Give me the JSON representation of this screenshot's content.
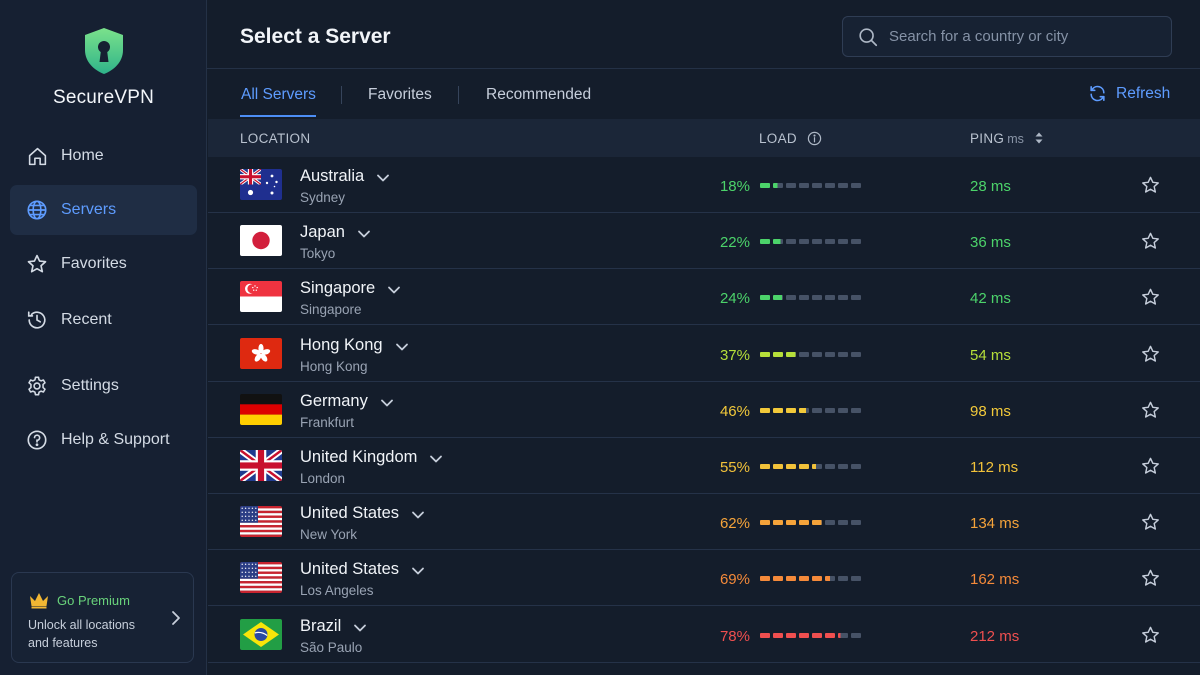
{
  "app": {
    "brand": "SecureVPN",
    "colors": {
      "accent": "#5e9cff",
      "brand_green": "#5fd38a",
      "premium_gold": "#f2b733",
      "background": "#141d2b"
    }
  },
  "sidebar": {
    "items": [
      {
        "label": "Home",
        "icon": "home-icon",
        "active": false
      },
      {
        "label": "Servers",
        "icon": "globe-icon",
        "active": true
      },
      {
        "label": "Favorites",
        "icon": "star-icon",
        "active": false
      },
      {
        "label": "Recent",
        "icon": "history-icon",
        "active": false
      },
      {
        "label": "Settings",
        "icon": "gear-icon",
        "active": false
      },
      {
        "label": "Help & Support",
        "icon": "help-icon",
        "active": false
      }
    ],
    "premium": {
      "title": "Go Premium",
      "subtitle": "Unlock all locations and features",
      "icon": "crown-icon"
    }
  },
  "header": {
    "title": "Select a Server",
    "search_placeholder": "Search for a country or city"
  },
  "tabs": [
    {
      "label": "All Servers",
      "active": true
    },
    {
      "label": "Favorites",
      "active": false
    },
    {
      "label": "Recommended",
      "active": false
    }
  ],
  "refresh_label": "Refresh",
  "table": {
    "col_location": "LOCATION",
    "col_load": "LOAD",
    "col_ping": "PING",
    "col_ping_unit": "ms",
    "rows": [
      {
        "country": "Australia",
        "city": "Sydney",
        "flag": "au",
        "load": "18%",
        "load_value": 0.18,
        "ping": "28 ms",
        "color": "#4cd36a"
      },
      {
        "country": "Japan",
        "city": "Tokyo",
        "flag": "jp",
        "load": "22%",
        "load_value": 0.22,
        "ping": "36 ms",
        "color": "#4cd36a"
      },
      {
        "country": "Singapore",
        "city": "Singapore",
        "flag": "sg",
        "load": "24%",
        "load_value": 0.24,
        "ping": "42 ms",
        "color": "#4cd36a"
      },
      {
        "country": "Hong Kong",
        "city": "Hong Kong",
        "flag": "hk",
        "load": "37%",
        "load_value": 0.37,
        "ping": "54 ms",
        "color": "#b6df3a"
      },
      {
        "country": "Germany",
        "city": "Frankfurt",
        "flag": "de",
        "load": "46%",
        "load_value": 0.46,
        "ping": "98 ms",
        "color": "#f2c93a"
      },
      {
        "country": "United Kingdom",
        "city": "London",
        "flag": "gb",
        "load": "55%",
        "load_value": 0.55,
        "ping": "112 ms",
        "color": "#f2c23a"
      },
      {
        "country": "United States",
        "city": "New York",
        "flag": "us",
        "load": "62%",
        "load_value": 0.62,
        "ping": "134 ms",
        "color": "#f5a33a"
      },
      {
        "country": "United States",
        "city": "Los Angeles",
        "flag": "us",
        "load": "69%",
        "load_value": 0.69,
        "ping": "162 ms",
        "color": "#f58a3a"
      },
      {
        "country": "Brazil",
        "city": "São Paulo",
        "flag": "br",
        "load": "78%",
        "load_value": 0.78,
        "ping": "212 ms",
        "color": "#ef4f4f"
      }
    ]
  }
}
